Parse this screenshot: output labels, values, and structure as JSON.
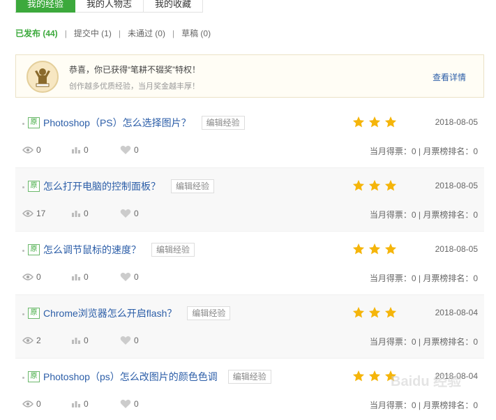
{
  "tabs": [
    {
      "label": "我的经验",
      "active": true
    },
    {
      "label": "我的人物志",
      "active": false
    },
    {
      "label": "我的收藏",
      "active": false
    }
  ],
  "filters": [
    {
      "label": "已发布 (44)",
      "active": true
    },
    {
      "label": "提交中 (1)",
      "active": false
    },
    {
      "label": "未通过 (0)",
      "active": false
    },
    {
      "label": "草稿 (0)",
      "active": false
    }
  ],
  "filter_separator": "|",
  "notice": {
    "title": "恭喜，你已获得“笔耕不辍奖”特权！",
    "subtitle": "创作越多优质经验，当月奖金越丰厚！",
    "link": "查看详情"
  },
  "items": [
    {
      "badge": "原",
      "title": "Photoshop（PS）怎么选择图片？",
      "edit": "编辑经验",
      "date": "2018-08-05",
      "views": "0",
      "votes": "0",
      "likes": "0",
      "rank": "当月得票：0 | 月票榜排名：0"
    },
    {
      "badge": "原",
      "title": "怎么打开电脑的控制面板？",
      "edit": "编辑经验",
      "date": "2018-08-05",
      "views": "17",
      "votes": "0",
      "likes": "0",
      "rank": "当月得票：0 | 月票榜排名：0"
    },
    {
      "badge": "原",
      "title": "怎么调节鼠标的速度？",
      "edit": "编辑经验",
      "date": "2018-08-05",
      "views": "0",
      "votes": "0",
      "likes": "0",
      "rank": "当月得票：0 | 月票榜排名：0"
    },
    {
      "badge": "原",
      "title": "Chrome浏览器怎么开启flash？",
      "edit": "编辑经验",
      "date": "2018-08-04",
      "views": "2",
      "votes": "0",
      "likes": "0",
      "rank": "当月得票：0 | 月票榜排名：0"
    },
    {
      "badge": "原",
      "title": "Photoshop（ps）怎么改图片的颜色色调",
      "edit": "编辑经验",
      "date": "2018-08-04",
      "views": "0",
      "votes": "0",
      "likes": "0",
      "rank": "当月得票：0 | 月票榜排名：0"
    }
  ],
  "watermark": "Baidu 经验",
  "colors": {
    "accent": "#3ca93c",
    "link": "#2c5ea8",
    "star": "#f5b50a"
  }
}
